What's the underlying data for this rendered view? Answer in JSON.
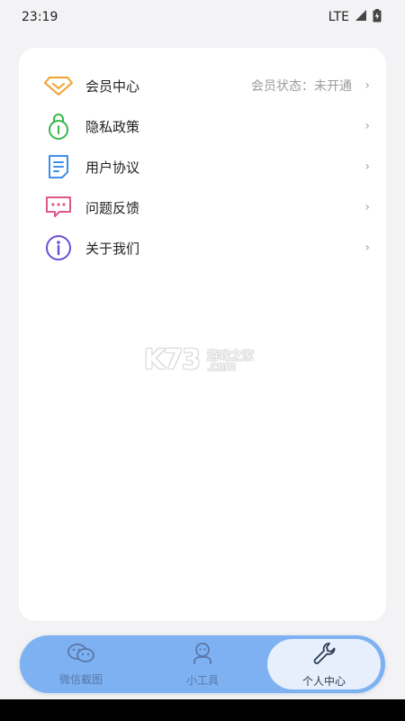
{
  "status_bar": {
    "time": "23:19",
    "network": "LTE",
    "signal_icon": "signal-icon",
    "battery_icon": "battery-charging-icon"
  },
  "menu": {
    "items": [
      {
        "label": "会员中心",
        "status": "会员状态：未开通",
        "icon": "diamond-icon",
        "icon_color": "#f0a12a"
      },
      {
        "label": "隐私政策",
        "status": "",
        "icon": "lock-icon",
        "icon_color": "#36b84a"
      },
      {
        "label": "用户协议",
        "status": "",
        "icon": "document-icon",
        "icon_color": "#3f8ee8"
      },
      {
        "label": "问题反馈",
        "status": "",
        "icon": "message-icon",
        "icon_color": "#e0568a"
      },
      {
        "label": "关于我们",
        "status": "",
        "icon": "info-icon",
        "icon_color": "#6c4fd1"
      }
    ],
    "chevron": "›"
  },
  "watermark": {
    "logo": "K73",
    "line1": "游戏之家",
    "line2": ".com"
  },
  "tabbar": {
    "tabs": [
      {
        "label": "微信截图",
        "icon": "wechat-icon",
        "active": false
      },
      {
        "label": "小工具",
        "icon": "tools-person-icon",
        "active": false
      },
      {
        "label": "个人中心",
        "icon": "wrench-icon",
        "active": true
      }
    ],
    "color": "#7db1f2",
    "active_color": "#e6effb"
  }
}
